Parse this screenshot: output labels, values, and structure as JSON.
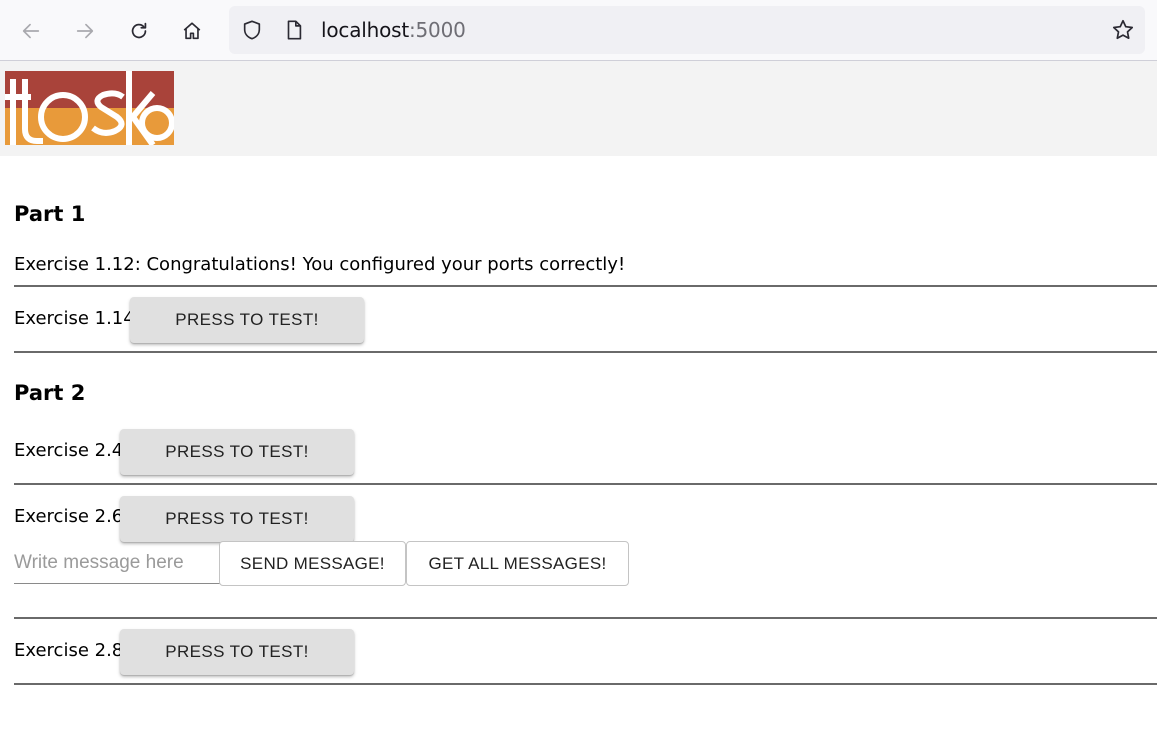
{
  "browser": {
    "url_host": "localhost",
    "url_port": ":5000"
  },
  "header": {
    "logo_text": "toska"
  },
  "parts": [
    {
      "title": "Part 1"
    },
    {
      "title": "Part 2"
    }
  ],
  "exercises": {
    "e1_12": {
      "label": "Exercise 1.12: Congratulations! You configured your ports correctly!"
    },
    "e1_14": {
      "label": "Exercise 1.14:",
      "button": "PRESS TO TEST!"
    },
    "e2_4": {
      "label": "Exercise 2.4:",
      "button": "PRESS TO TEST!"
    },
    "e2_6": {
      "label": "Exercise 2.6:",
      "button": "PRESS TO TEST!",
      "input_placeholder": "Write message here",
      "send_button": "SEND MESSAGE!",
      "get_button": "GET ALL MESSAGES!"
    },
    "e2_8": {
      "label": "Exercise 2.8:",
      "button": "PRESS TO TEST!"
    }
  },
  "colors": {
    "logo_red": "#a9433a",
    "logo_orange": "#e89a3a",
    "button_gray": "#e0e0e0"
  }
}
